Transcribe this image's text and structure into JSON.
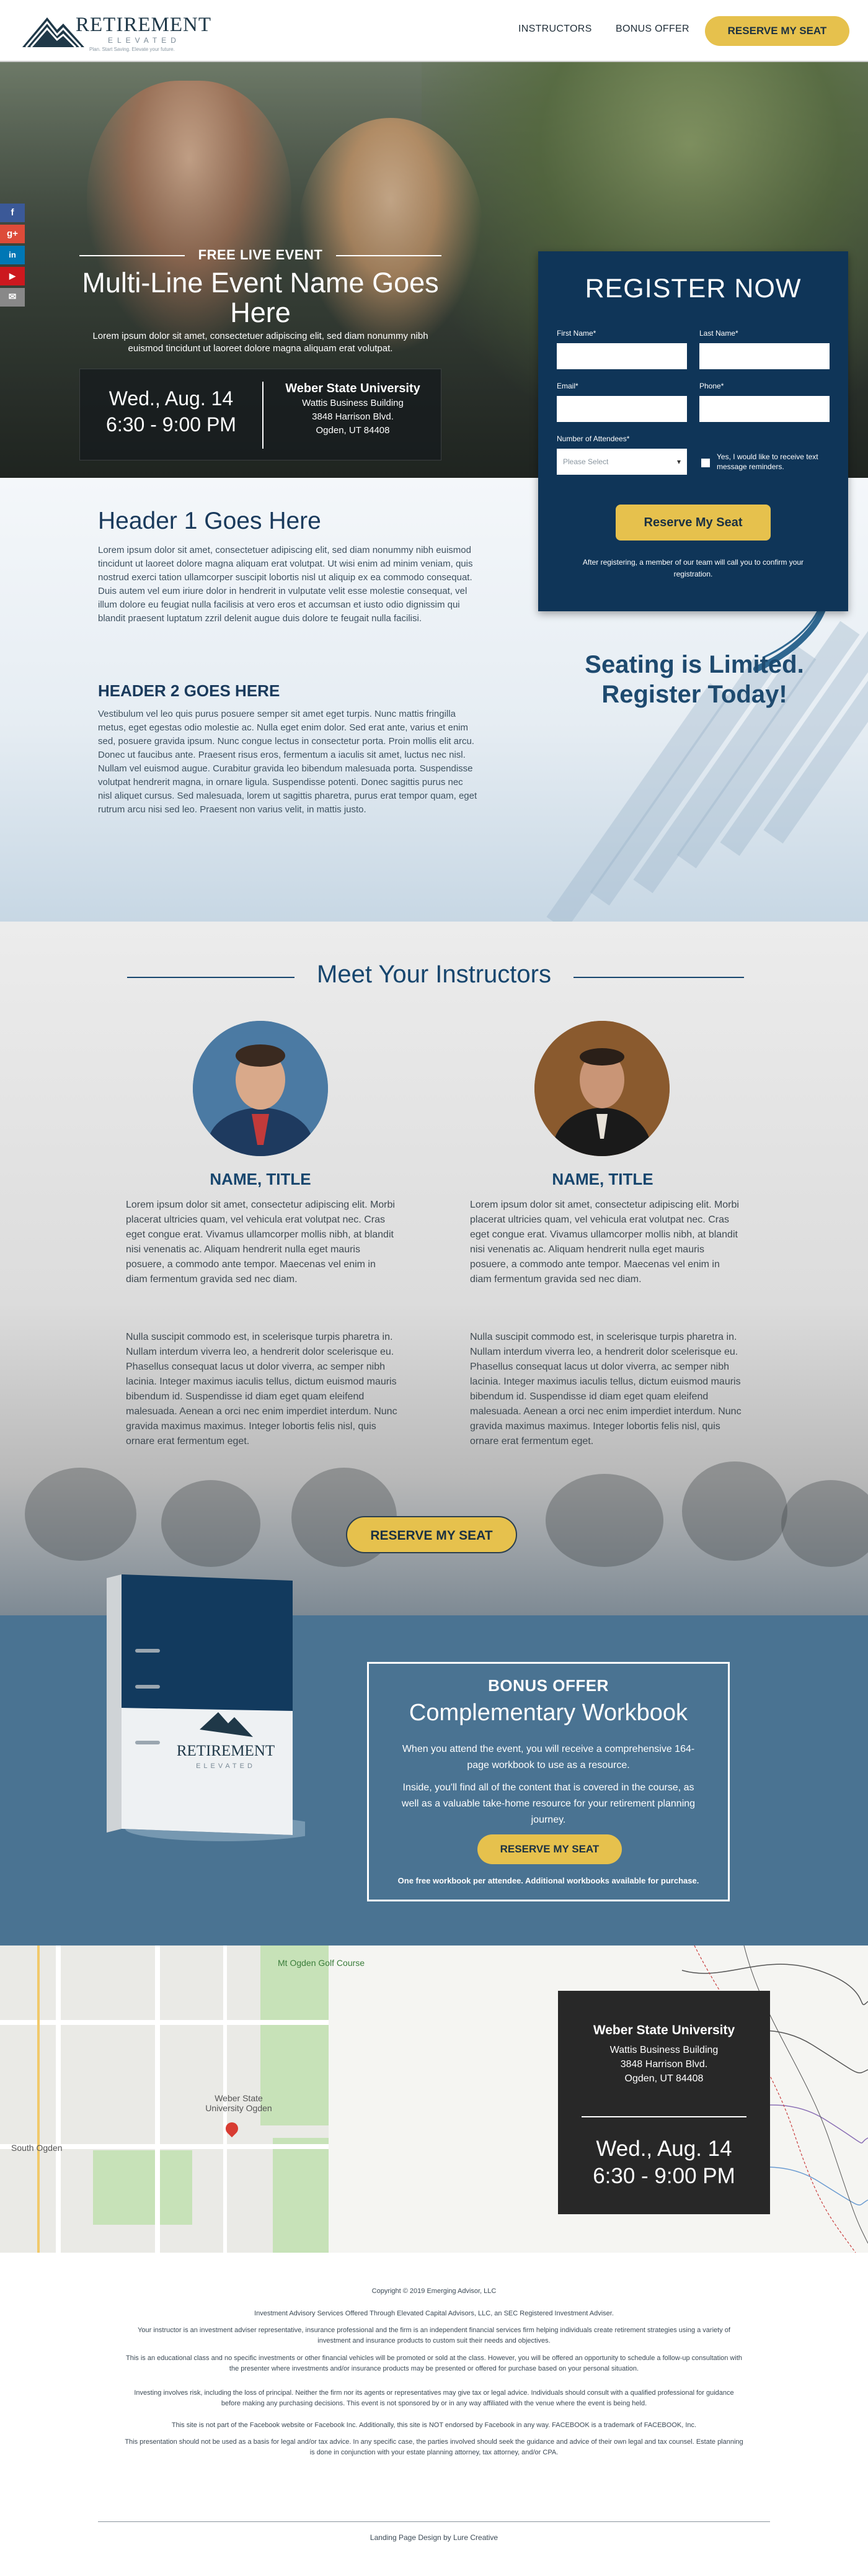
{
  "brand": {
    "name": "RETIREMENT",
    "sub": "ELEVATED",
    "tagline": "Plan. Start Saving. Elevate your future."
  },
  "nav": {
    "instructors": "INSTRUCTORS",
    "bonus": "BONUS OFFER",
    "reserve": "RESERVE MY SEAT"
  },
  "social": [
    "f",
    "g+",
    "in",
    "▶",
    "✉"
  ],
  "hero": {
    "eyebrow": "FREE LIVE EVENT",
    "event_name": "Multi-Line Event Name Goes Here",
    "description": "Lorem ipsum dolor sit amet, consectetuer adipiscing elit, sed diam nonummy nibh euismod tincidunt ut laoreet dolore magna aliquam erat volutpat.",
    "date": "Wed., Aug. 14",
    "time": "6:30 - 9:00 PM",
    "venue_name": "Weber State University",
    "venue_building": "Wattis Business Building",
    "venue_street": "3848 Harrison Blvd.",
    "venue_city": "Ogden, UT 84408"
  },
  "register": {
    "title": "REGISTER NOW",
    "first_name_label": "First Name*",
    "last_name_label": "Last Name*",
    "email_label": "Email*",
    "phone_label": "Phone*",
    "attendees_label": "Number of Attendees*",
    "attendees_value": "Please Select",
    "sms_label": "Yes, I would like to receive text message reminders.",
    "submit": "Reserve My Seat",
    "note": "After registering, a member of our team will call you to confirm your registration."
  },
  "content": {
    "header1": "Header 1 Goes Here",
    "para1": "Lorem ipsum dolor sit amet, consectetuer adipiscing elit, sed diam nonummy nibh euismod tincidunt ut laoreet dolore magna aliquam erat volutpat. Ut wisi enim ad minim veniam, quis nostrud exerci tation ullamcorper suscipit lobortis nisl ut aliquip ex ea commodo consequat. Duis autem vel eum iriure dolor in hendrerit in vulputate velit esse molestie consequat, vel illum dolore eu feugiat nulla facilisis at vero eros et accumsan et iusto odio dignissim qui blandit praesent luptatum zzril delenit augue duis dolore te feugait nulla facilisi.",
    "header2": "HEADER 2 GOES HERE",
    "para2": "Vestibulum vel leo quis purus posuere semper sit amet eget turpis. Nunc mattis fringilla metus, eget egestas odio molestie ac. Nulla eget enim dolor. Sed erat ante, varius et enim sed, posuere gravida ipsum. Nunc congue lectus in consectetur porta. Proin mollis elit arcu. Donec ut faucibus ante. Praesent risus eros, fermentum a iaculis sit amet, luctus nec nisl. Nullam vel euismod augue. Curabitur gravida leo bibendum malesuada porta. Suspendisse volutpat hendrerit magna, in ornare ligula. Suspendisse potenti. Donec sagittis purus nec nisl aliquet cursus. Sed malesuada, lorem ut sagittis pharetra, purus erat tempor quam, eget rutrum arcu nisi sed leo. Praesent non varius velit, in mattis justo.",
    "seating_line1": "Seating is Limited.",
    "seating_line2": "Register Today!"
  },
  "instructors": {
    "title": "Meet Your Instructors",
    "items": [
      {
        "name": "NAME, TITLE",
        "p1": "Lorem ipsum dolor sit amet, consectetur adipiscing elit. Morbi placerat ultricies quam, vel vehicula erat volutpat nec. Cras eget congue erat. Vivamus ullamcorper mollis nibh, at blandit nisi venenatis ac. Aliquam hendrerit nulla eget mauris posuere, a commodo ante tempor. Maecenas vel enim in diam fermentum gravida sed nec diam.",
        "p2": "Nulla suscipit commodo est, in scelerisque turpis pharetra in. Nullam interdum viverra leo, a hendrerit dolor scelerisque eu. Phasellus consequat lacus ut dolor viverra, ac semper nibh lacinia. Integer maximus iaculis tellus, dictum euismod mauris bibendum id. Suspendisse id diam eget quam eleifend malesuada. Aenean a orci nec enim imperdiet interdum. Nunc gravida maximus maximus. Integer lobortis felis nisl, quis ornare erat fermentum eget."
      },
      {
        "name": "NAME, TITLE",
        "p1": "Lorem ipsum dolor sit amet, consectetur adipiscing elit. Morbi placerat ultricies quam, vel vehicula erat volutpat nec. Cras eget congue erat. Vivamus ullamcorper mollis nibh, at blandit nisi venenatis ac. Aliquam hendrerit nulla eget mauris posuere, a commodo ante tempor. Maecenas vel enim in diam fermentum gravida sed nec diam.",
        "p2": "Nulla suscipit commodo est, in scelerisque turpis pharetra in. Nullam interdum viverra leo, a hendrerit dolor scelerisque eu. Phasellus consequat lacus ut dolor viverra, ac semper nibh lacinia. Integer maximus iaculis tellus, dictum euismod mauris bibendum id. Suspendisse id diam eget quam eleifend malesuada. Aenean a orci nec enim imperdiet interdum. Nunc gravida maximus maximus. Integer lobortis felis nisl, quis ornare erat fermentum eget."
      }
    ],
    "reserve": "RESERVE MY SEAT"
  },
  "bonus": {
    "eyebrow": "BONUS OFFER",
    "title": "Complementary Workbook",
    "para1": "When you attend the event, you will receive a comprehensive 164-page workbook to use as a resource.",
    "para2": "Inside, you'll find all of the content that is covered in the course, as well as a valuable take-home resource for your retirement planning journey.",
    "button": "RESERVE MY SEAT",
    "note": "One free workbook per attendee. Additional workbooks available for purchase."
  },
  "map": {
    "label_golf": "Mt Ogden Golf Course",
    "label_weber": "Weber State University Ogden",
    "label_south": "South Ogden",
    "venue_name": "Weber State University",
    "venue_building": "Wattis Business Building",
    "venue_street": "3848 Harrison Blvd.",
    "venue_city": "Ogden, UT 84408",
    "date": "Wed., Aug. 14",
    "time": "6:30 - 9:00 PM"
  },
  "footer": {
    "copyright": "Copyright © 2019 Emerging Advisor, LLC",
    "line1": "Investment Advisory Services Offered Through Elevated Capital Advisors, LLC, an SEC Registered Investment Adviser.",
    "line2": "Your instructor is an investment adviser representative, insurance professional and the firm is an independent financial services firm helping individuals create retirement strategies using a variety of investment and insurance products to custom suit their needs and objectives.",
    "line3": "This is an educational class and no specific investments or other financial vehicles will be promoted or sold at the class. However, you will be offered an opportunity to schedule a follow-up consultation with the presenter where investments and/or insurance products may be presented or offered for purchase based on your personal situation.",
    "line4": "Investing involves risk, including the loss of principal. Neither the firm nor its agents or representatives may give tax or legal advice. Individuals should consult with a qualified professional for guidance before making any purchasing decisions. This event is not sponsored by or in any way affiliated with the venue where the event is being held.",
    "line5": "This site is not part of the Facebook website or Facebook Inc. Additionally, this site is NOT endorsed by Facebook in any way. FACEBOOK is a trademark of FACEBOOK, Inc.",
    "line6": "This presentation should not be used as a basis for legal and/or tax advice. In any specific case, the parties involved should seek the guidance and advice of their own legal and tax counsel. Estate planning is done in conjunction with your estate planning attorney, tax attorney, and/or CPA.",
    "design": "Landing Page Design by Lure Creative"
  },
  "colors": {
    "navy": "#0f3558",
    "gold": "#e6c14d",
    "steel_blue": "#4a7392",
    "heading_blue": "#17466e"
  }
}
